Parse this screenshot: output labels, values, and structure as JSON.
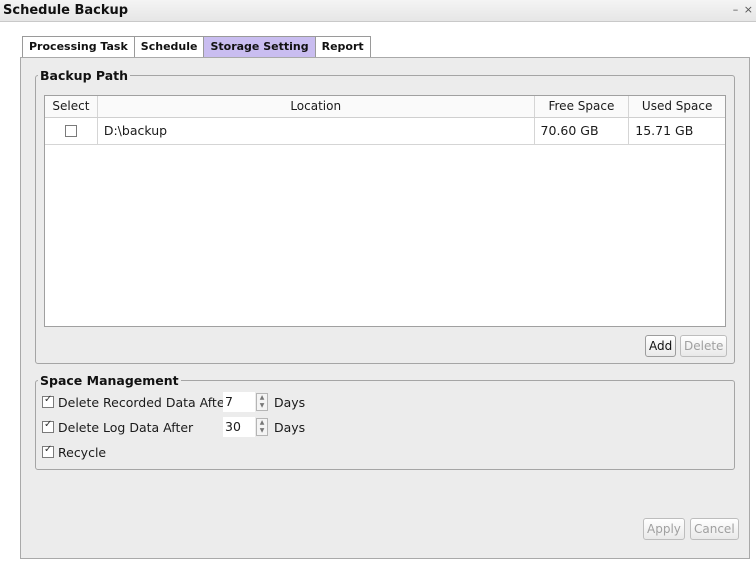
{
  "window": {
    "title": "Schedule Backup",
    "controls": "– ×"
  },
  "tabs": [
    {
      "label": "Processing Task",
      "active": false
    },
    {
      "label": "Schedule",
      "active": false
    },
    {
      "label": "Storage Setting",
      "active": true
    },
    {
      "label": "Report",
      "active": false
    }
  ],
  "backup_path": {
    "legend": "Backup Path",
    "columns": [
      "Select",
      "Location",
      "Free Space",
      "Used Space"
    ],
    "rows": [
      {
        "selected": false,
        "location": "D:\\backup",
        "free_space": "70.60 GB",
        "used_space": "15.71 GB"
      }
    ],
    "add_label": "Add",
    "delete_label": "Delete"
  },
  "space_management": {
    "legend": "Space Management",
    "delete_recorded": {
      "label": "Delete Recorded Data After",
      "checked": true,
      "value": "7",
      "unit": "Days"
    },
    "delete_log": {
      "label": "Delete Log Data After",
      "checked": true,
      "value": "30",
      "unit": "Days"
    },
    "recycle": {
      "label": "Recycle",
      "checked": true
    }
  },
  "footer": {
    "apply_label": "Apply",
    "cancel_label": "Cancel"
  },
  "colors": {
    "active_tab": "#c9bdf0",
    "panel_bg": "#ececec"
  }
}
